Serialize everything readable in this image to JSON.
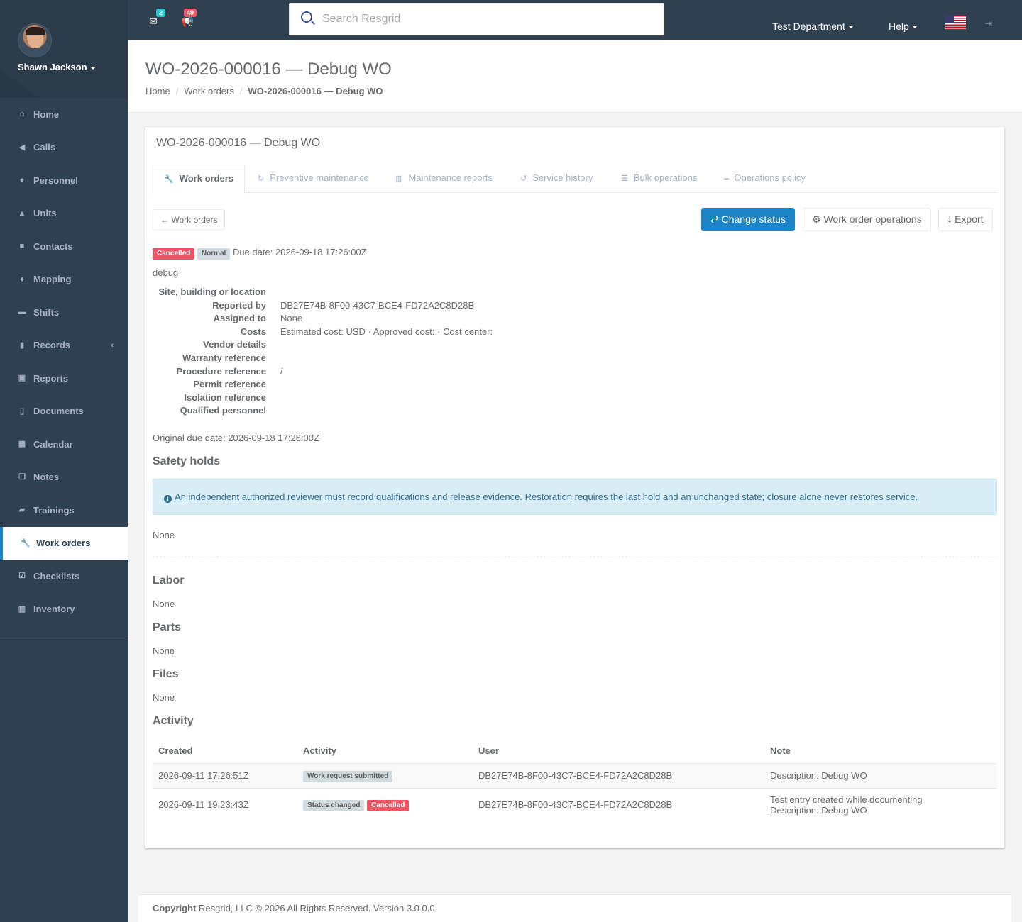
{
  "user": {
    "name": "Shawn Jackson"
  },
  "topbar": {
    "mail_count": "2",
    "alerts_count": "49",
    "search_placeholder": "Search Resgrid",
    "department": "Test Department",
    "help": "Help"
  },
  "sidebar": {
    "items": [
      {
        "label": "Home",
        "icon": "home-icon"
      },
      {
        "label": "Calls",
        "icon": "bullhorn-icon"
      },
      {
        "label": "Personnel",
        "icon": "user-icon"
      },
      {
        "label": "Units",
        "icon": "truck-icon"
      },
      {
        "label": "Contacts",
        "icon": "contact-book-icon"
      },
      {
        "label": "Mapping",
        "icon": "map-marker-icon"
      },
      {
        "label": "Shifts",
        "icon": "shifts-icon"
      },
      {
        "label": "Records",
        "icon": "file-icon"
      },
      {
        "label": "Reports",
        "icon": "reports-icon"
      },
      {
        "label": "Documents",
        "icon": "documents-icon"
      },
      {
        "label": "Calendar",
        "icon": "calendar-icon"
      },
      {
        "label": "Notes",
        "icon": "notes-icon"
      },
      {
        "label": "Trainings",
        "icon": "book-icon"
      },
      {
        "label": "Work orders",
        "icon": "wrench-icon"
      },
      {
        "label": "Checklists",
        "icon": "checkbox-icon"
      },
      {
        "label": "Inventory",
        "icon": "barcode-icon"
      }
    ]
  },
  "heading": {
    "title": "WO-2026-000016 — Debug WO",
    "breadcrumb": [
      "Home",
      "Work orders",
      "WO-2026-000016 — Debug WO"
    ]
  },
  "box": {
    "title": "WO-2026-000016 — Debug WO",
    "tabs": [
      "Work orders",
      "Preventive maintenance",
      "Maintenance reports",
      "Service history",
      "Bulk operations",
      "Operations policy"
    ],
    "back_button": "Work orders",
    "change_status": "Change status",
    "operations": "Work order operations",
    "export": "Export",
    "status_label": "Cancelled",
    "priority_label": "Normal",
    "due_date": "Due date: 2026-09-18 17:26:00Z",
    "description": "debug",
    "details": [
      {
        "label": "Site, building or location",
        "value": ""
      },
      {
        "label": "Reported by",
        "value": "DB27E74B-8F00-43C7-BCE4-FD72A2C8D28B"
      },
      {
        "label": "Assigned to",
        "value": "None"
      },
      {
        "label": "Costs",
        "value": "Estimated cost: USD · Approved cost: · Cost center:"
      },
      {
        "label": "Vendor details",
        "value": ""
      },
      {
        "label": "Warranty reference",
        "value": ""
      },
      {
        "label": "Procedure reference",
        "value": "/"
      },
      {
        "label": "Permit reference",
        "value": ""
      },
      {
        "label": "Isolation reference",
        "value": ""
      },
      {
        "label": "Qualified personnel",
        "value": ""
      }
    ],
    "original_due": "Original due date: 2026-09-18 17:26:00Z",
    "safety_holds": "Safety holds",
    "alert_text": "An independent authorized reviewer must record qualifications and release evidence. Restoration requires the last hold and an unchanged state; closure alone never restores service.",
    "none": "None",
    "labor": "Labor",
    "parts": "Parts",
    "files": "Files",
    "activity": "Activity",
    "activity_headers": [
      "Created",
      "Activity",
      "User",
      "Note"
    ],
    "activity_rows": [
      {
        "created": "2026-09-11 17:26:51Z",
        "activity": "Work request submitted",
        "extra": "",
        "user": "DB27E74B-8F00-43C7-BCE4-FD72A2C8D28B",
        "note1": "Description: Debug WO",
        "note2": ""
      },
      {
        "created": "2026-09-11 19:23:43Z",
        "activity": "Status changed",
        "extra": "Cancelled",
        "user": "DB27E74B-8F00-43C7-BCE4-FD72A2C8D28B",
        "note1": "Test entry created while documenting",
        "note2": "Description: Debug WO"
      }
    ]
  },
  "footer": {
    "copyright": "Copyright",
    "text": " Resgrid, LLC © 2026 All Rights Reserved. Version 3.0.0.0"
  },
  "colors": {
    "sidebar": "#2f4050",
    "primary": "#1c84c6",
    "danger": "#ed5565"
  }
}
